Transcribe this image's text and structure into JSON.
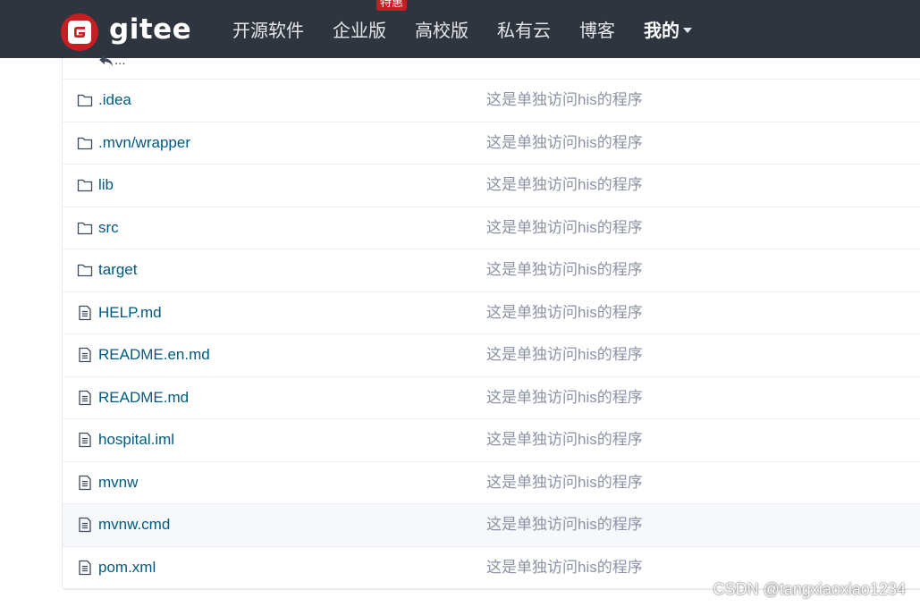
{
  "header": {
    "logo_text": "gitee",
    "nav": [
      {
        "label": "开源软件"
      },
      {
        "label": "企业版",
        "badge": "特惠"
      },
      {
        "label": "高校版"
      },
      {
        "label": "私有云"
      },
      {
        "label": "博客"
      },
      {
        "label": "我的"
      }
    ]
  },
  "tree": {
    "up_label": "...",
    "rows": [
      {
        "type": "folder",
        "name": ".idea",
        "message": "这是单独访问his的程序"
      },
      {
        "type": "folder",
        "name": ".mvn/wrapper",
        "message": "这是单独访问his的程序"
      },
      {
        "type": "folder",
        "name": "lib",
        "message": "这是单独访问his的程序"
      },
      {
        "type": "folder",
        "name": "src",
        "message": "这是单独访问his的程序"
      },
      {
        "type": "folder",
        "name": "target",
        "message": "这是单独访问his的程序"
      },
      {
        "type": "file",
        "name": "HELP.md",
        "message": "这是单独访问his的程序"
      },
      {
        "type": "file",
        "name": "README.en.md",
        "message": "这是单独访问his的程序"
      },
      {
        "type": "file",
        "name": "README.md",
        "message": "这是单独访问his的程序"
      },
      {
        "type": "file",
        "name": "hospital.iml",
        "message": "这是单独访问his的程序"
      },
      {
        "type": "file",
        "name": "mvnw",
        "message": "这是单独访问his的程序"
      },
      {
        "type": "file",
        "name": "mvnw.cmd",
        "message": "这是单独访问his的程序"
      },
      {
        "type": "file",
        "name": "pom.xml",
        "message": "这是单独访问his的程序"
      }
    ]
  },
  "watermark": "CSDN @tangxiaoxiao1234",
  "colors": {
    "header_bg": "#2f353f",
    "brand_red": "#c71d23",
    "link": "#005980",
    "muted": "#8c92a4"
  }
}
